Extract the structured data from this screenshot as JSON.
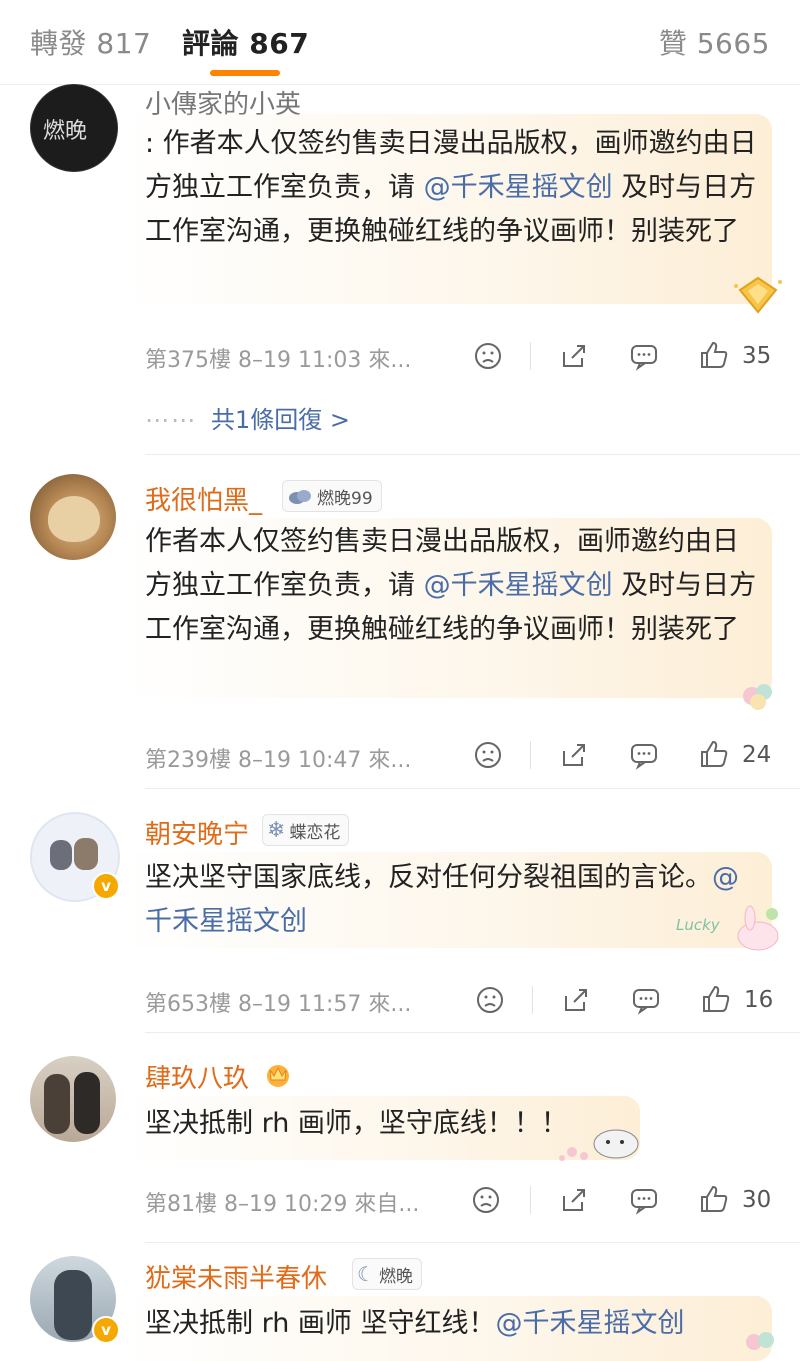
{
  "tabs": {
    "forward": "轉發 817",
    "comments": "評論 867",
    "likes": "贊 5665"
  },
  "comments": [
    {
      "username": "小傳家的小英",
      "avatar_text": "燃晚",
      "text_prefix": ": 作者本人仅签约售卖日漫出品版权，画师邀约由日方独立工作室负责，请 ",
      "mention": "@千禾星摇文创",
      "text_suffix": " 及时与日方工作室沟通，更换触碰红线的争议画师！别装死了",
      "meta": "第375樓 8–19 11:03 來...",
      "likes": "35",
      "replies": "共1條回復 >",
      "dots": "⋯⋯"
    },
    {
      "username": "我很怕黑_",
      "badge": "燃晚99",
      "text_prefix": "作者本人仅签约售卖日漫出品版权，画师邀约由日方独立工作室负责，请 ",
      "mention": "@千禾星摇文创",
      "text_suffix": " 及时与日方工作室沟通，更换触碰红线的争议画师！别装死了",
      "meta": "第239樓 8–19 10:47 來...",
      "likes": "24"
    },
    {
      "username": "朝安晚宁",
      "badge": "蝶恋花",
      "text_prefix": "坚决坚守国家底线，反对任何分裂祖国的言论。",
      "mention": "@千禾星摇文创",
      "text_suffix": "",
      "meta": "第653樓 8–19 11:57 來...",
      "likes": "16",
      "sticker": "Lucky"
    },
    {
      "username": "肆玖八玖",
      "text_prefix": "坚决抵制 rh 画师，坚守底线！！！",
      "mention": "",
      "text_suffix": "",
      "meta": "第81樓 8–19 10:29 來自...",
      "likes": "30"
    },
    {
      "username": "犹棠未雨半春休",
      "badge": "燃晚",
      "text_prefix": "坚决抵制 rh 画师 坚守红线！",
      "mention": "@千禾星摇文创",
      "text_suffix": "",
      "meta": "",
      "likes": ""
    }
  ],
  "colors": {
    "accent": "#ff8200",
    "mention": "#4a6da8",
    "username": "#e06c1a",
    "verified": "#f5a800"
  },
  "icons": {
    "dislike": "sad-face-icon",
    "share": "share-icon",
    "comment": "comment-icon",
    "like": "thumb-up-icon"
  }
}
